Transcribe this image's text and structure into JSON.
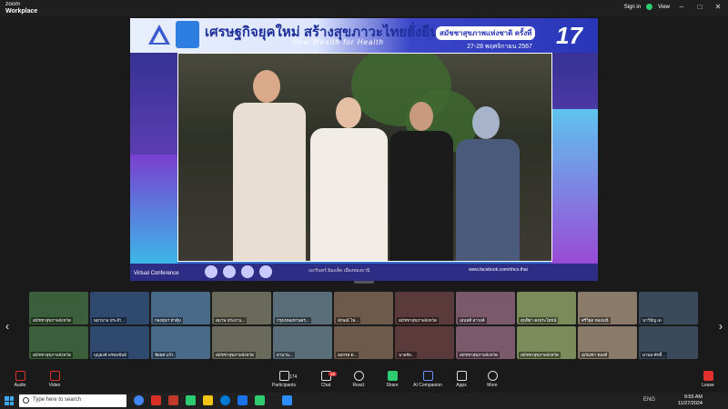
{
  "app": {
    "brand_line1": "zoom",
    "brand_line2": "Workplace"
  },
  "titlebar": {
    "sign_in": "Sign in",
    "view": "View",
    "minimize": "–",
    "maximize": "□",
    "close": "✕"
  },
  "stage": {
    "banner_main": "เศรษฐกิจยุคใหม่ สร้างสุขภาวะไทยยั่งยืน",
    "banner_sub": "New Wealth for Health",
    "banner_right_title": "สมัชชาสุขภาพแห่งชาติ ครั้งที่",
    "banner_dates": "27-28 พฤศจิกายน 2567",
    "banner_number": "17",
    "virtual_label": "Virtual Conference",
    "footer_text": "เอกรินทร์ อิมแพ็ค เมืองทองธานี",
    "footer_url": "www.facebook.com/nhco.thai"
  },
  "participants": [
    {
      "name": "สมัชชาสุขภาพจังหวัด"
    },
    {
      "name": "พยาบาล ประจำ..."
    },
    {
      "name": "กองทุนฯ ท่าตุ้ม"
    },
    {
      "name": "สมาพ ประธาน..."
    },
    {
      "name": "กรุงเทพมหานคร..."
    },
    {
      "name": "ลักษณ์ ไฟ..."
    },
    {
      "name": "สมัชชาสุขภาพจังหวัด"
    },
    {
      "name": "เสนหดี สาวงค์"
    },
    {
      "name": "สุนทิยา คงประโยชน์"
    },
    {
      "name": "ศรีวิยุต ทองมณี"
    },
    {
      "name": "นาวีห์ญ เด"
    },
    {
      "name": "สมัชชาสุขภาพจังหวัด"
    },
    {
      "name": "บุญยงค์ พรหมขันธ์"
    },
    {
      "name": "ชัยยศ แก้ว"
    },
    {
      "name": "สมัชชาสุขภาพจังหวัด"
    },
    {
      "name": "ยานาน..."
    },
    {
      "name": "ออกรส ต..."
    },
    {
      "name": "นายชัย..."
    },
    {
      "name": "สมัชชาสุขภาพจังหวัด"
    },
    {
      "name": "สมัชชาสุขภาพจังหวัด"
    },
    {
      "name": "สุภัณฑา ทองดี"
    },
    {
      "name": "มานพ ศักดิ์..."
    }
  ],
  "toolbar": {
    "audio": "Audio",
    "video": "Video",
    "participants": "Participants",
    "participants_count": "174",
    "chat": "Chat",
    "chat_badge": "16",
    "react": "React",
    "share": "Share",
    "ai": "AI Companion",
    "apps": "Apps",
    "more": "More",
    "leave": "Leave"
  },
  "taskbar": {
    "search_placeholder": "Type here to search",
    "time": "9:55 AM",
    "date": "11/27/2024",
    "lang": "ENG"
  },
  "colors": {
    "accent": "#2e7de0",
    "leave": "#e0312f",
    "badge": "#e0312f"
  }
}
